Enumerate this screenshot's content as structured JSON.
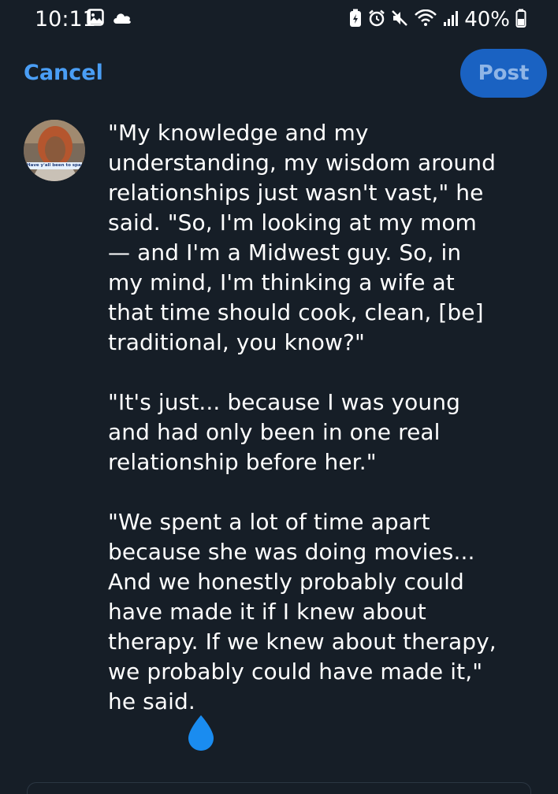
{
  "status_bar": {
    "time": "10:11",
    "battery_percent": "40%",
    "left_icons": [
      "gallery-icon",
      "cloud-icon"
    ],
    "right_icons": [
      "battery-saver-icon",
      "alarm-icon",
      "mute-icon",
      "wifi-icon",
      "signal-icon",
      "battery-icon"
    ]
  },
  "toolbar": {
    "cancel_label": "Cancel",
    "post_label": "Post"
  },
  "avatar": {
    "caption": "Have y'all been to space?"
  },
  "post": {
    "paragraphs": [
      "\"My knowledge and my\nunderstanding, my wisdom around\nrelationships just wasn't vast,\" he\nsaid. \"So, I'm looking at my mom\n— and I'm a Midwest guy. So, in\nmy mind, I'm thinking a wife at\nthat time should cook, clean, [be]\ntraditional, you know?\"",
      "\"It's just... because I was young\nand had only been in one real\nrelationship before her.\"",
      "\"We spent a lot of time apart\nbecause she was doing movies...\nAnd we honestly probably could\nhave made it if I knew about\ntherapy. If we knew about therapy,\nwe probably could have made it,\"\nhe said."
    ]
  },
  "colors": {
    "background": "#161e27",
    "accent": "#4a9ef5",
    "post_button": "#1a62c2",
    "cursor_handle": "#1a8cf0"
  }
}
